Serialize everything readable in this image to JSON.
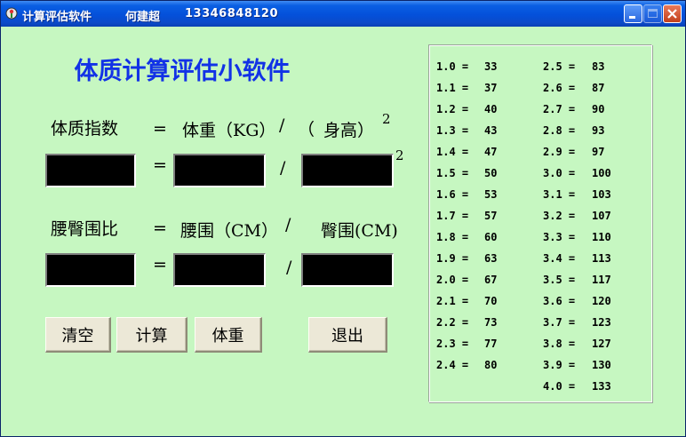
{
  "window": {
    "title": "计算评估软件",
    "author": "何建超",
    "phone": "13346848120"
  },
  "main_title": "体质计算评估小软件",
  "formula1": {
    "left": "体质指数",
    "eq": "=",
    "weight": "体重（KG）",
    "slash": "/",
    "paren_open": "（",
    "height": "身高）",
    "exp": "2"
  },
  "inputs1": {
    "eq": "=",
    "slash": "/",
    "exp": "2",
    "bmi_value": "",
    "weight_value": "",
    "height_value": ""
  },
  "formula2": {
    "left": "腰臀围比",
    "eq": "=",
    "waist": "腰围（CM）",
    "slash": "/",
    "hip": "臀围(CM)"
  },
  "inputs2": {
    "eq": "=",
    "slash": "/",
    "ratio_value": "",
    "waist_value": "",
    "hip_value": ""
  },
  "buttons": {
    "clear": "清空",
    "calculate": "计算",
    "weight": "体重",
    "exit": "退出"
  },
  "table": {
    "left": [
      {
        "h": "1.0 =",
        "w": "33"
      },
      {
        "h": "1.1 =",
        "w": "37"
      },
      {
        "h": "1.2 =",
        "w": "40"
      },
      {
        "h": "1.3 =",
        "w": "43"
      },
      {
        "h": "1.4 =",
        "w": "47"
      },
      {
        "h": "1.5 =",
        "w": "50"
      },
      {
        "h": "1.6 =",
        "w": "53"
      },
      {
        "h": "1.7 =",
        "w": "57"
      },
      {
        "h": "1.8 =",
        "w": "60"
      },
      {
        "h": "1.9 =",
        "w": "63"
      },
      {
        "h": "2.0 =",
        "w": "67"
      },
      {
        "h": "2.1 =",
        "w": "70"
      },
      {
        "h": "2.2 =",
        "w": "73"
      },
      {
        "h": "2.3 =",
        "w": "77"
      },
      {
        "h": "2.4 =",
        "w": "80"
      }
    ],
    "right": [
      {
        "h": "2.5 =",
        "w": "83"
      },
      {
        "h": "2.6 =",
        "w": "87"
      },
      {
        "h": "2.7 =",
        "w": "90"
      },
      {
        "h": "2.8 =",
        "w": "93"
      },
      {
        "h": "2.9 =",
        "w": "97"
      },
      {
        "h": "3.0 =",
        "w": "100"
      },
      {
        "h": "3.1 =",
        "w": "103"
      },
      {
        "h": "3.2 =",
        "w": "107"
      },
      {
        "h": "3.3 =",
        "w": "110"
      },
      {
        "h": "3.4 =",
        "w": "113"
      },
      {
        "h": "3.5 =",
        "w": "117"
      },
      {
        "h": "3.6 =",
        "w": "120"
      },
      {
        "h": "3.7 =",
        "w": "123"
      },
      {
        "h": "3.8 =",
        "w": "127"
      },
      {
        "h": "3.9 =",
        "w": "130"
      },
      {
        "h": "4.0 =",
        "w": "133"
      }
    ]
  },
  "icons": {
    "app": "app-icon",
    "minimize": "minimize-icon",
    "maximize": "maximize-icon",
    "close": "close-icon"
  },
  "colors": {
    "client_bg": "#c6f7c1",
    "title_blue": "#1232e6",
    "field_bg": "#000000"
  }
}
